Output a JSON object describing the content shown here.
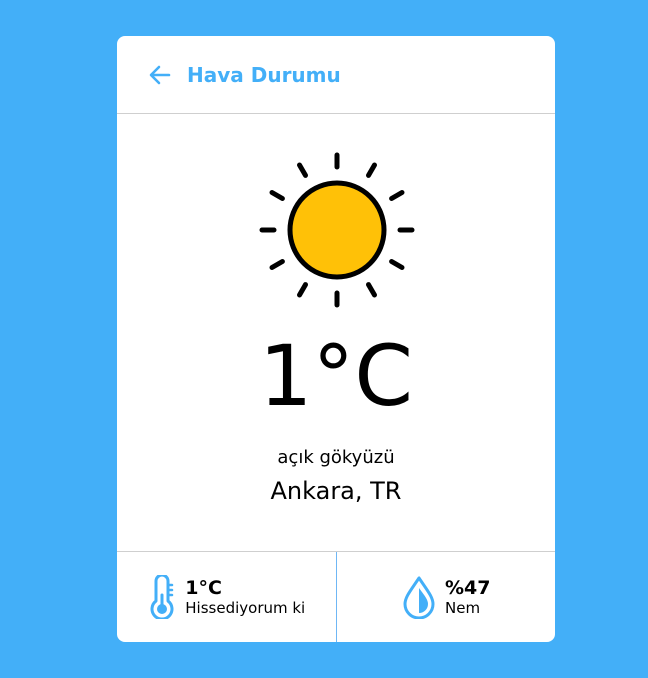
{
  "header": {
    "title": "Hava Durumu",
    "back_icon": "arrow-left-icon"
  },
  "weather": {
    "icon": "sun-icon",
    "temperature": "1°C",
    "description": "açık gökyüzü",
    "location": "Ankara, TR"
  },
  "details": {
    "feels_like": {
      "icon": "thermometer-icon",
      "value": "1°C",
      "label": "Hissediyorum ki"
    },
    "humidity": {
      "icon": "droplet-icon",
      "value": "%47",
      "label": "Nem"
    }
  },
  "colors": {
    "background": "#43aff8",
    "accent": "#43aff8",
    "sun_fill": "#ffc107"
  }
}
